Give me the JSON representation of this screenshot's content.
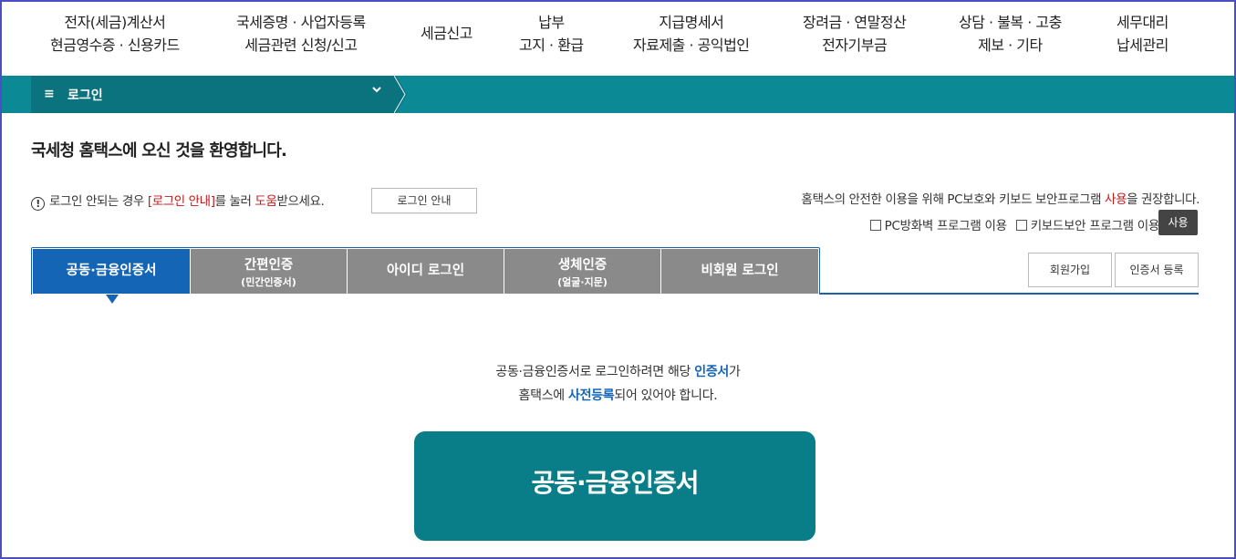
{
  "top_nav": [
    {
      "line1": "전자(세금)계산서",
      "line2": "현금영수증 · 신용카드"
    },
    {
      "line1": "국세증명 · 사업자등록",
      "line2": "세금관련 신청/신고"
    },
    {
      "line1": "세금신고",
      "line2": ""
    },
    {
      "line1": "납부",
      "line2": "고지 · 환급"
    },
    {
      "line1": "지급명세서",
      "line2": "자료제출 · 공익법인"
    },
    {
      "line1": "장려금 · 연말정산",
      "line2": "전자기부금"
    },
    {
      "line1": "상담 · 불복 · 고충",
      "line2": "제보 · 기타"
    },
    {
      "line1": "세무대리",
      "line2": "납세관리"
    }
  ],
  "breadcrumb": {
    "menu_icon": "≡",
    "label": "로그인",
    "chevron": "⌄"
  },
  "welcome": "국세청 홈택스에 오신 것을 환영합니다.",
  "notice": {
    "prefix": "로그인 안되는 경우 ",
    "link": "[로그인 안내]",
    "mid": "를 눌러 ",
    "help": "도움",
    "suffix": "받으세요.",
    "button": "로그인 안내"
  },
  "security": {
    "text_prefix": "홈택스의 안전한 이용을 위해 PC보호와 키보드 보안프로그램 ",
    "text_highlight": "사용",
    "text_suffix": "을 권장합니다.",
    "checkbox1": "PC방화벽 프로그램 이용",
    "checkbox2": "키보드보안 프로그램 이용",
    "use_button": "사용"
  },
  "tabs": [
    {
      "label": "공동·금융인증서",
      "sub": "",
      "active": true
    },
    {
      "label": "간편인증",
      "sub": "(민간인증서)",
      "active": false
    },
    {
      "label": "아이디 로그인",
      "sub": "",
      "active": false
    },
    {
      "label": "생체인증",
      "sub": "(얼굴·지문)",
      "active": false
    },
    {
      "label": "비회원 로그인",
      "sub": "",
      "active": false
    }
  ],
  "side_buttons": {
    "signup": "회원가입",
    "cert_register": "인증서 등록"
  },
  "info": {
    "line1_prefix": "공동·금융인증서로 로그인하려면 해당 ",
    "line1_highlight": "인증서",
    "line1_suffix": "가",
    "line2_prefix": "홈택스에 ",
    "line2_highlight": "사전등록",
    "line2_suffix": "되어 있어야 합니다."
  },
  "main_button": "공동·금융인증서",
  "colors": {
    "teal": "#0b8a96",
    "active_tab": "#1565b6",
    "red": "#c21919"
  }
}
